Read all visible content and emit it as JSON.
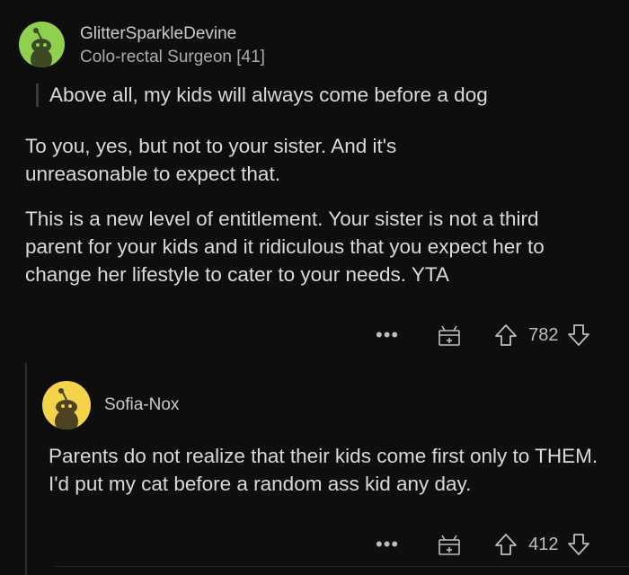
{
  "comments": [
    {
      "username": "GlitterSparkleDevine",
      "flair": "Colo-rectal Surgeon [41]",
      "avatar_color": "#8fd14f",
      "quote": "Above all, my kids will always come before a dog",
      "paragraphs": [
        "To you, yes, but not to your sister.  And it's unreasonable to expect that.",
        "This is a new level of entitlement.  Your sister is not a third parent for your kids and it ridiculous that you expect her to change her lifestyle to cater to your needs. YTA"
      ],
      "more_icon": "•••",
      "award_icon": "gift-icon",
      "upvote_icon": "upvote-arrow-icon",
      "score": "782",
      "downvote_icon": "downvote-arrow-icon"
    },
    {
      "username": "Sofia-Nox",
      "avatar_color": "#f2d34a",
      "paragraphs": [
        "Parents do not realize that their kids come first only to THEM. I'd put my cat before a random ass kid any day."
      ],
      "more_icon": "•••",
      "award_icon": "gift-icon",
      "upvote_icon": "upvote-arrow-icon",
      "score": "412",
      "downvote_icon": "downvote-arrow-icon"
    }
  ]
}
